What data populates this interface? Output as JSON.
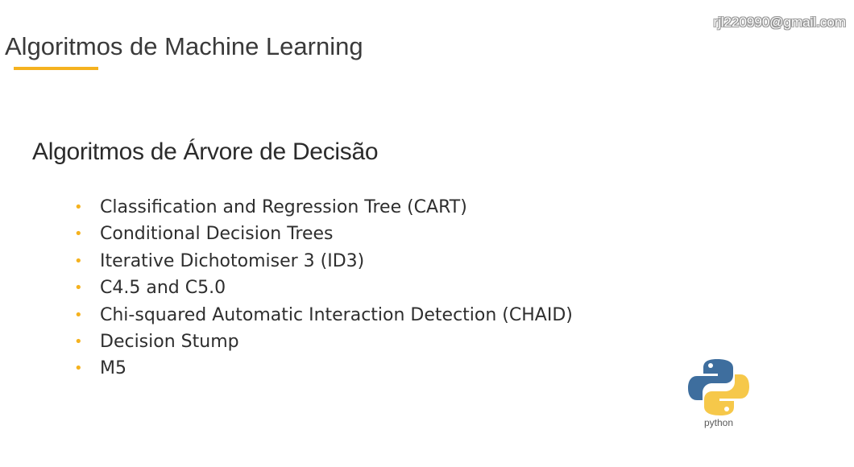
{
  "watermark": "rjl220990@gmail.com",
  "page_title": "Algoritmos de Machine Learning",
  "section_heading": "Algoritmos de Árvore de Decisão",
  "bullet_glyph": "•",
  "algorithms": [
    "Classification and Regression Tree (CART)",
    "Conditional Decision Trees",
    "Iterative Dichotomiser 3 (ID3)",
    "C4.5 and C5.0",
    "Chi-squared Automatic Interaction Detection (CHAID)",
    "Decision Stump",
    "M5"
  ],
  "python_logo": {
    "icon": "python-logo-icon",
    "wordmark": "python",
    "blue": "#3e6e9e",
    "yellow": "#f6c84a"
  },
  "colors": {
    "accent": "#f5b21f",
    "title_text": "#3a3a3a",
    "body_text": "#2e2e2e"
  }
}
